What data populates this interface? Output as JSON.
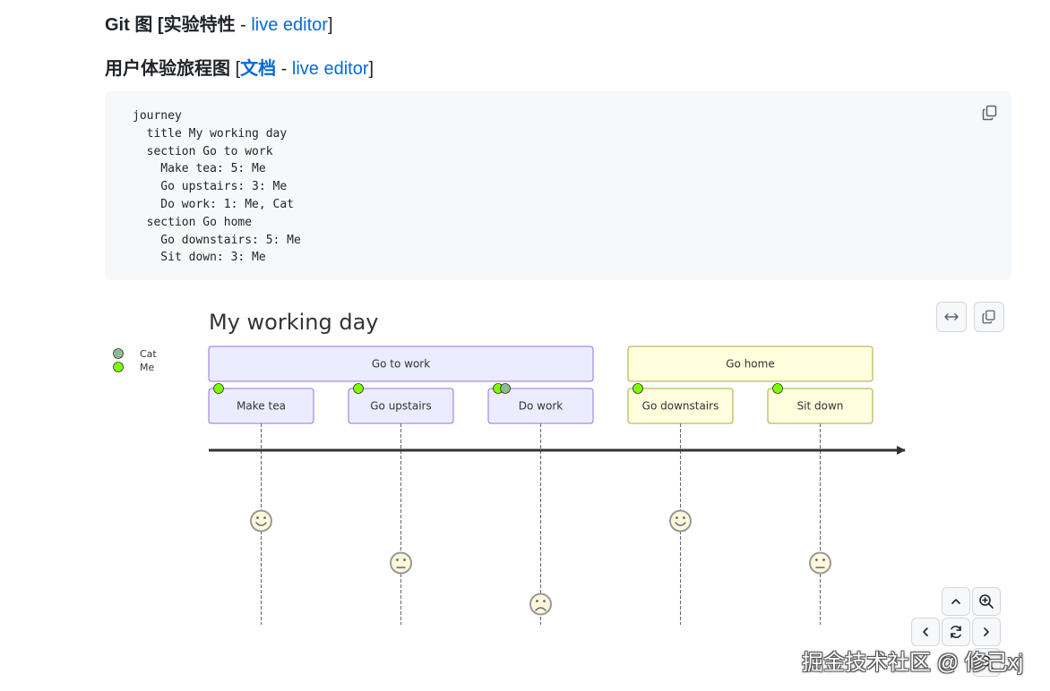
{
  "headings": {
    "git": {
      "title": "Git 图",
      "bracket_open": "[",
      "status": "实验特性",
      "sep": " - ",
      "live_editor": "live editor",
      "bracket_close": "]"
    },
    "journey": {
      "title": "用户体验旅程图",
      "bracket_open": "[",
      "docs": "文档",
      "sep": " - ",
      "live_editor": "live editor",
      "bracket_close": "]"
    }
  },
  "code": {
    "lines": [
      "journey",
      "  title My working day",
      "  section Go to work",
      "    Make tea: 5: Me",
      "    Go upstairs: 3: Me",
      "    Do work: 1: Me, Cat",
      "  section Go home",
      "    Go downstairs: 5: Me",
      "    Sit down: 3: Me"
    ]
  },
  "diagram": {
    "title": "My working day",
    "actors": [
      {
        "name": "Cat",
        "color": "#8fbc8f"
      },
      {
        "name": "Me",
        "color": "#7fff00"
      }
    ],
    "sections": [
      {
        "name": "Go to work",
        "fill": "#ececff",
        "stroke": "#9370db",
        "tasks": [
          {
            "name": "Make tea",
            "score": 5,
            "actors": [
              "Me"
            ]
          },
          {
            "name": "Go upstairs",
            "score": 3,
            "actors": [
              "Me"
            ]
          },
          {
            "name": "Do work",
            "score": 1,
            "actors": [
              "Me",
              "Cat"
            ]
          }
        ]
      },
      {
        "name": "Go home",
        "fill": "#ffffde",
        "stroke": "#aaaa33",
        "tasks": [
          {
            "name": "Go downstairs",
            "score": 5,
            "actors": [
              "Me"
            ]
          },
          {
            "name": "Sit down",
            "score": 3,
            "actors": [
              "Me"
            ]
          }
        ]
      }
    ]
  },
  "toolbar": {
    "icons": [
      "expand-horizontal-icon",
      "copy-icon"
    ]
  },
  "pan_zoom": {
    "icons": [
      "chevron-up-icon",
      "zoom-in-icon",
      "chevron-left-icon",
      "reset-icon",
      "chevron-right-icon",
      "zoom-out-icon"
    ]
  },
  "watermark": "掘金技术社区 @ 修己xj"
}
